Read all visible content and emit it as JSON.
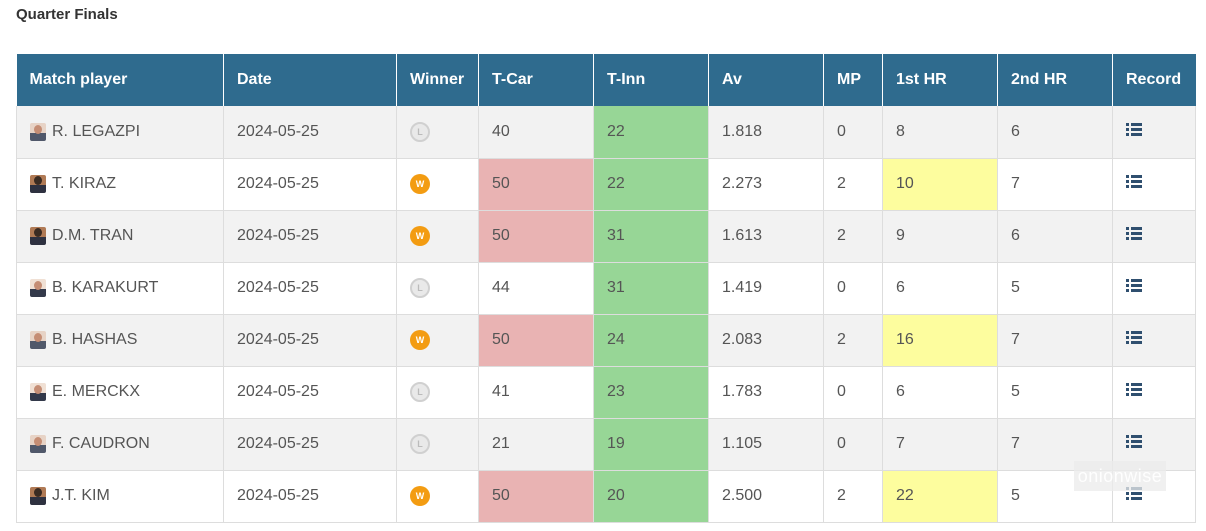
{
  "section_title": "Quarter Finals",
  "columns": [
    "Match player",
    "Date",
    "Winner",
    "T-Car",
    "T-Inn",
    "Av",
    "MP",
    "1st HR",
    "2nd HR",
    "Record"
  ],
  "colors": {
    "header_bg": "#2f6b8e",
    "winner_badge": "#f39c12",
    "loser_badge": "#e9e9e9",
    "highlight_tcar": "#e9b3b3",
    "highlight_tinn": "#97d696",
    "highlight_hr": "#fdfd9e"
  },
  "badges": {
    "win": "W",
    "loss": "L"
  },
  "rows": [
    {
      "player": "R. LEGAZPI",
      "date": "2024-05-25",
      "result": "L",
      "tcar": "40",
      "tinn": "22",
      "av": "1.818",
      "mp": "0",
      "hr1": "8",
      "hr2": "6"
    },
    {
      "player": "T. KIRAZ",
      "date": "2024-05-25",
      "result": "W",
      "tcar": "50",
      "tinn": "22",
      "av": "2.273",
      "mp": "2",
      "hr1": "10",
      "hr2": "7"
    },
    {
      "player": "D.M. TRAN",
      "date": "2024-05-25",
      "result": "W",
      "tcar": "50",
      "tinn": "31",
      "av": "1.613",
      "mp": "2",
      "hr1": "9",
      "hr2": "6"
    },
    {
      "player": "B. KARAKURT",
      "date": "2024-05-25",
      "result": "L",
      "tcar": "44",
      "tinn": "31",
      "av": "1.419",
      "mp": "0",
      "hr1": "6",
      "hr2": "5"
    },
    {
      "player": "B. HASHAS",
      "date": "2024-05-25",
      "result": "W",
      "tcar": "50",
      "tinn": "24",
      "av": "2.083",
      "mp": "2",
      "hr1": "16",
      "hr2": "7"
    },
    {
      "player": "E. MERCKX",
      "date": "2024-05-25",
      "result": "L",
      "tcar": "41",
      "tinn": "23",
      "av": "1.783",
      "mp": "0",
      "hr1": "6",
      "hr2": "5"
    },
    {
      "player": "F. CAUDRON",
      "date": "2024-05-25",
      "result": "L",
      "tcar": "21",
      "tinn": "19",
      "av": "1.105",
      "mp": "0",
      "hr1": "7",
      "hr2": "7"
    },
    {
      "player": "J.T. KIM",
      "date": "2024-05-25",
      "result": "W",
      "tcar": "50",
      "tinn": "20",
      "av": "2.500",
      "mp": "2",
      "hr1": "22",
      "hr2": "5"
    }
  ],
  "watermark": "onionwise"
}
